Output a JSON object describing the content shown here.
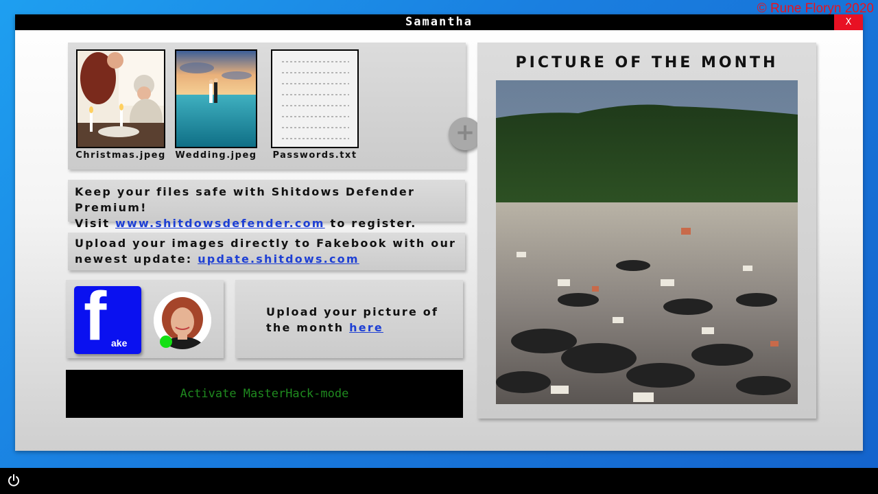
{
  "watermark": "© Rune Floryn 2020",
  "window": {
    "title": "Samantha",
    "close_label": "X"
  },
  "files": [
    {
      "name": "Christmas.jpeg",
      "icon": "photo-thumbnail"
    },
    {
      "name": "Wedding.jpeg",
      "icon": "photo-thumbnail"
    },
    {
      "name": "Passwords.txt",
      "icon": "text-document-icon"
    }
  ],
  "add_button": {
    "label": "+"
  },
  "promo1": {
    "line1": "Keep your files safe with Shitdows Defender Premium!",
    "prefix": "Visit",
    "link": "www.shitdowsdefender.com",
    "suffix": "to register."
  },
  "promo2": {
    "line1": "Upload your images directly to Fakebook with our",
    "prefix": "newest update:",
    "link": "update.shitdows.com"
  },
  "fakebook": {
    "letter": "f",
    "suffix": "ake",
    "brand_color": "#0a11f0",
    "status_color": "#14e014"
  },
  "upload": {
    "line1": "Upload your picture of",
    "prefix": "the month",
    "link": "here"
  },
  "hack": {
    "label": "Activate MasterHack-mode",
    "color": "#1f8a1f"
  },
  "potm": {
    "title": "PICTURE OF THE MONTH"
  },
  "colors": {
    "close": "#e81123",
    "link": "#1d3fd4",
    "watermark": "#e8141e"
  }
}
